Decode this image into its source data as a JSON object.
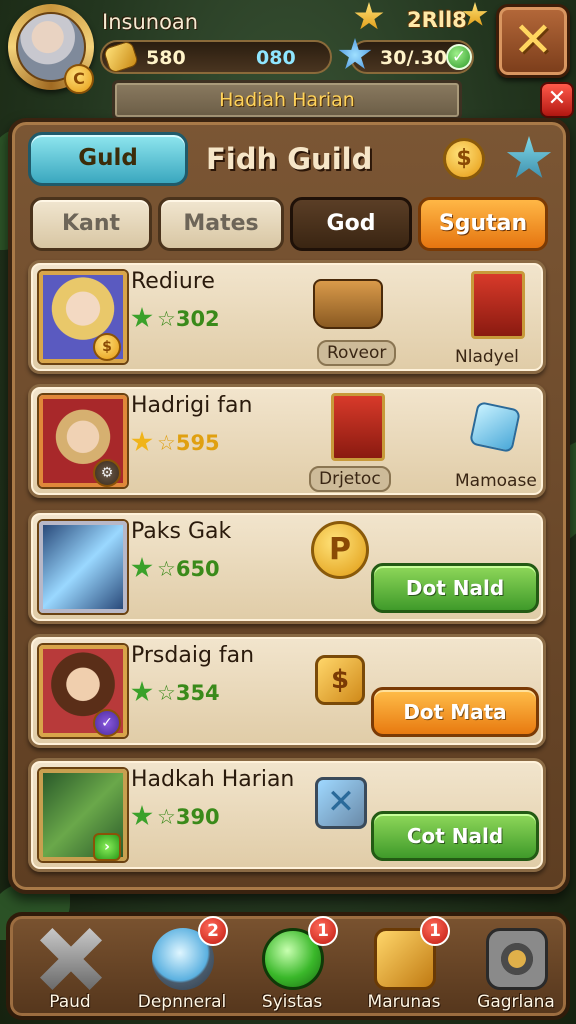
{
  "player": {
    "name": "Insunoan",
    "gold": "580",
    "gems": "080",
    "energy": "30/.30",
    "level_text": "2Rll8"
  },
  "daily_banner": "Hadiah Harian",
  "panel": {
    "guild_button": "Guld",
    "title": "Fidh Guild"
  },
  "tabs": [
    {
      "label": "Kant"
    },
    {
      "label": "Mates"
    },
    {
      "label": "God"
    },
    {
      "label": "Sgutan"
    }
  ],
  "rows": [
    {
      "name": "Rediure",
      "score": "☆302",
      "star_color": "#3aa12a",
      "score_color": "#3a8a1a",
      "item1_label": "Roveor",
      "item2_label": "Nladyel"
    },
    {
      "name": "Hadrigi fan",
      "score": "☆595",
      "star_color": "#f0b41a",
      "score_color": "#e0a010",
      "item1_label": "Drjetoc",
      "item2_label": "Mamoase"
    },
    {
      "name": "Paks Gak",
      "score": "☆650",
      "star_color": "#3aa12a",
      "score_color": "#3a8a1a",
      "button_label": "Dot Nald",
      "button_style": "green"
    },
    {
      "name": "Prsdaig fan",
      "score": "☆354",
      "star_color": "#3aa12a",
      "score_color": "#3a8a1a",
      "button_label": "Dot Mata",
      "button_style": "orange"
    },
    {
      "name": "Hadkah Harian",
      "score": "☆390",
      "star_color": "#3aa12a",
      "score_color": "#3a8a1a",
      "button_label": "Cot Nald",
      "button_style": "green"
    }
  ],
  "bottom_nav": [
    {
      "label": "Paud",
      "badge": ""
    },
    {
      "label": "Depnneral",
      "badge": "2"
    },
    {
      "label": "Syistas",
      "badge": "1"
    },
    {
      "label": "Marunas",
      "badge": "1"
    },
    {
      "label": "Gagrlana",
      "badge": ""
    }
  ]
}
